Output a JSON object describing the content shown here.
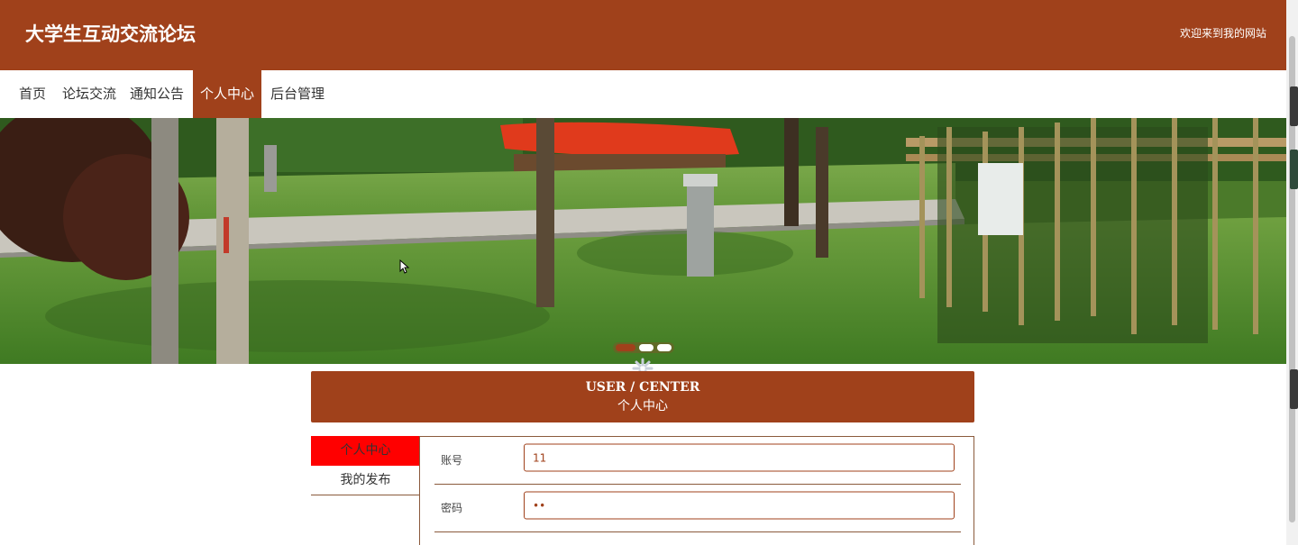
{
  "header": {
    "site_title": "大学生互动交流论坛",
    "welcome": "欢迎来到我的网站"
  },
  "nav": {
    "items": [
      {
        "label": "首页",
        "active": false
      },
      {
        "label": "论坛交流",
        "active": false
      },
      {
        "label": "通知公告",
        "active": false
      },
      {
        "label": "个人中心",
        "active": true
      },
      {
        "label": "后台管理",
        "active": false
      }
    ]
  },
  "banner": {
    "slide_count": 3,
    "active_slide": 1
  },
  "section": {
    "title_en": "USER / CENTER",
    "title_cn": "个人中心"
  },
  "sidebar": {
    "items": [
      {
        "label": "个人中心",
        "active": true
      },
      {
        "label": "我的发布",
        "active": false
      }
    ]
  },
  "form": {
    "account_label": "账号",
    "account_value": "11",
    "password_label": "密码",
    "password_value": "••"
  },
  "colors": {
    "brand": "#a0411b",
    "sidebar_active": "#ff0000"
  },
  "icons": {
    "loading": "loading-spinner-icon",
    "cursor": "mouse-cursor-icon"
  }
}
